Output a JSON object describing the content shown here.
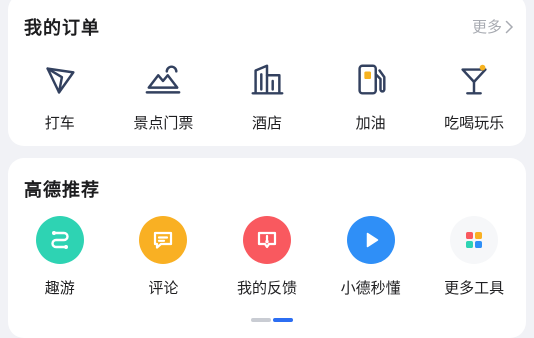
{
  "orders": {
    "title": "我的订单",
    "more_label": "更多",
    "items": [
      {
        "label": "打车",
        "icon": "taxi-arrow-icon"
      },
      {
        "label": "景点门票",
        "icon": "scenic-mountain-icon"
      },
      {
        "label": "酒店",
        "icon": "hotel-building-icon"
      },
      {
        "label": "加油",
        "icon": "gas-pump-icon"
      },
      {
        "label": "吃喝玩乐",
        "icon": "cocktail-icon"
      }
    ]
  },
  "recommend": {
    "title": "高德推荐",
    "items": [
      {
        "label": "趣游",
        "icon": "route-icon",
        "color": "#2ed3b3"
      },
      {
        "label": "评论",
        "icon": "comment-icon",
        "color": "#f9b023"
      },
      {
        "label": "我的反馈",
        "icon": "feedback-icon",
        "color": "#f9595f"
      },
      {
        "label": "小德秒懂",
        "icon": "play-icon",
        "color": "#2f8ff7"
      },
      {
        "label": "更多工具",
        "icon": "tools-grid-icon",
        "color": "#f6f7f9"
      }
    ]
  },
  "pager": {
    "active_color": "#2c6ef2",
    "inactive_color": "#c9ccd3"
  }
}
